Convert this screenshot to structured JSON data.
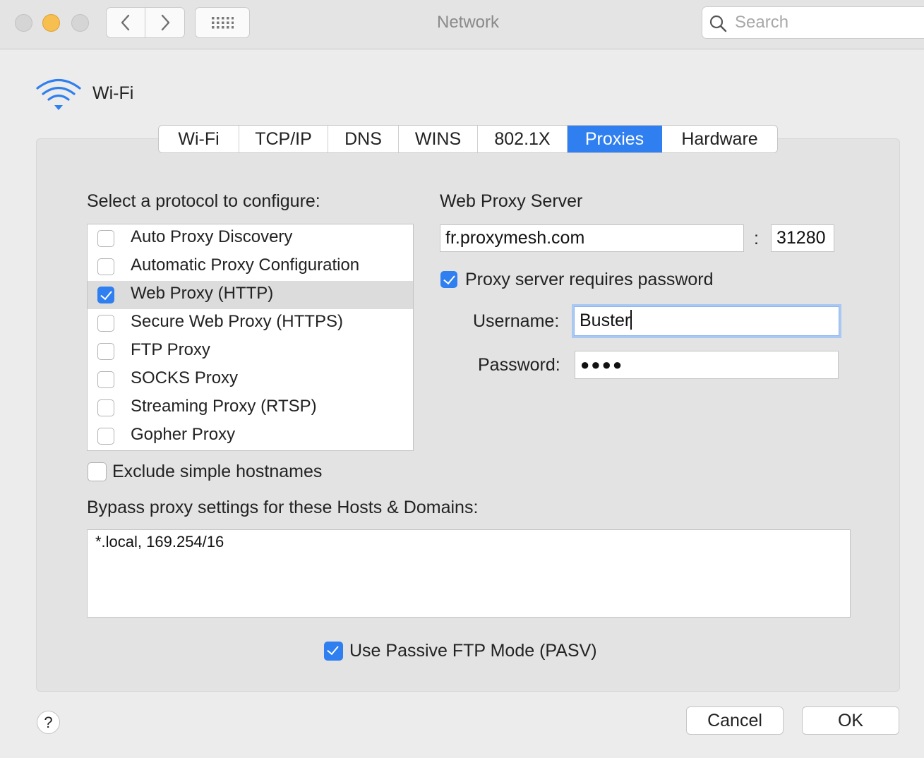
{
  "window": {
    "title": "Network"
  },
  "toolbar": {
    "back_icon": "chevron-left-icon",
    "forward_icon": "chevron-right-icon",
    "grid_icon": "grid-icon",
    "search_placeholder": "Search"
  },
  "header": {
    "interface_name": "Wi-Fi",
    "icon": "wifi-icon"
  },
  "tabs": [
    {
      "label": "Wi-Fi",
      "active": false
    },
    {
      "label": "TCP/IP",
      "active": false
    },
    {
      "label": "DNS",
      "active": false
    },
    {
      "label": "WINS",
      "active": false
    },
    {
      "label": "802.1X",
      "active": false
    },
    {
      "label": "Proxies",
      "active": true
    },
    {
      "label": "Hardware",
      "active": false
    }
  ],
  "protocols": {
    "heading": "Select a protocol to configure:",
    "items": [
      {
        "label": "Auto Proxy Discovery",
        "checked": false
      },
      {
        "label": "Automatic Proxy Configuration",
        "checked": false
      },
      {
        "label": "Web Proxy (HTTP)",
        "checked": true,
        "selected": true
      },
      {
        "label": "Secure Web Proxy (HTTPS)",
        "checked": false
      },
      {
        "label": "FTP Proxy",
        "checked": false
      },
      {
        "label": "SOCKS Proxy",
        "checked": false
      },
      {
        "label": "Streaming Proxy (RTSP)",
        "checked": false
      },
      {
        "label": "Gopher Proxy",
        "checked": false
      }
    ]
  },
  "proxy_server": {
    "heading": "Web Proxy Server",
    "host": "fr.proxymesh.com",
    "separator": ":",
    "port": "31280",
    "requires_password_label": "Proxy server requires password",
    "requires_password": true,
    "username_label": "Username:",
    "username": "Buster",
    "password_label": "Password:",
    "password_mask": "●●●●"
  },
  "exclude_simple": {
    "label": "Exclude simple hostnames",
    "checked": false
  },
  "bypass": {
    "label": "Bypass proxy settings for these Hosts & Domains:",
    "value": "*.local, 169.254/16"
  },
  "passive_ftp": {
    "label": "Use Passive FTP Mode (PASV)",
    "checked": true
  },
  "footer": {
    "help": "?",
    "cancel": "Cancel",
    "ok": "OK"
  },
  "colors": {
    "accent": "#2f7ff0",
    "panel": "#e3e3e3",
    "window": "#ececec"
  }
}
